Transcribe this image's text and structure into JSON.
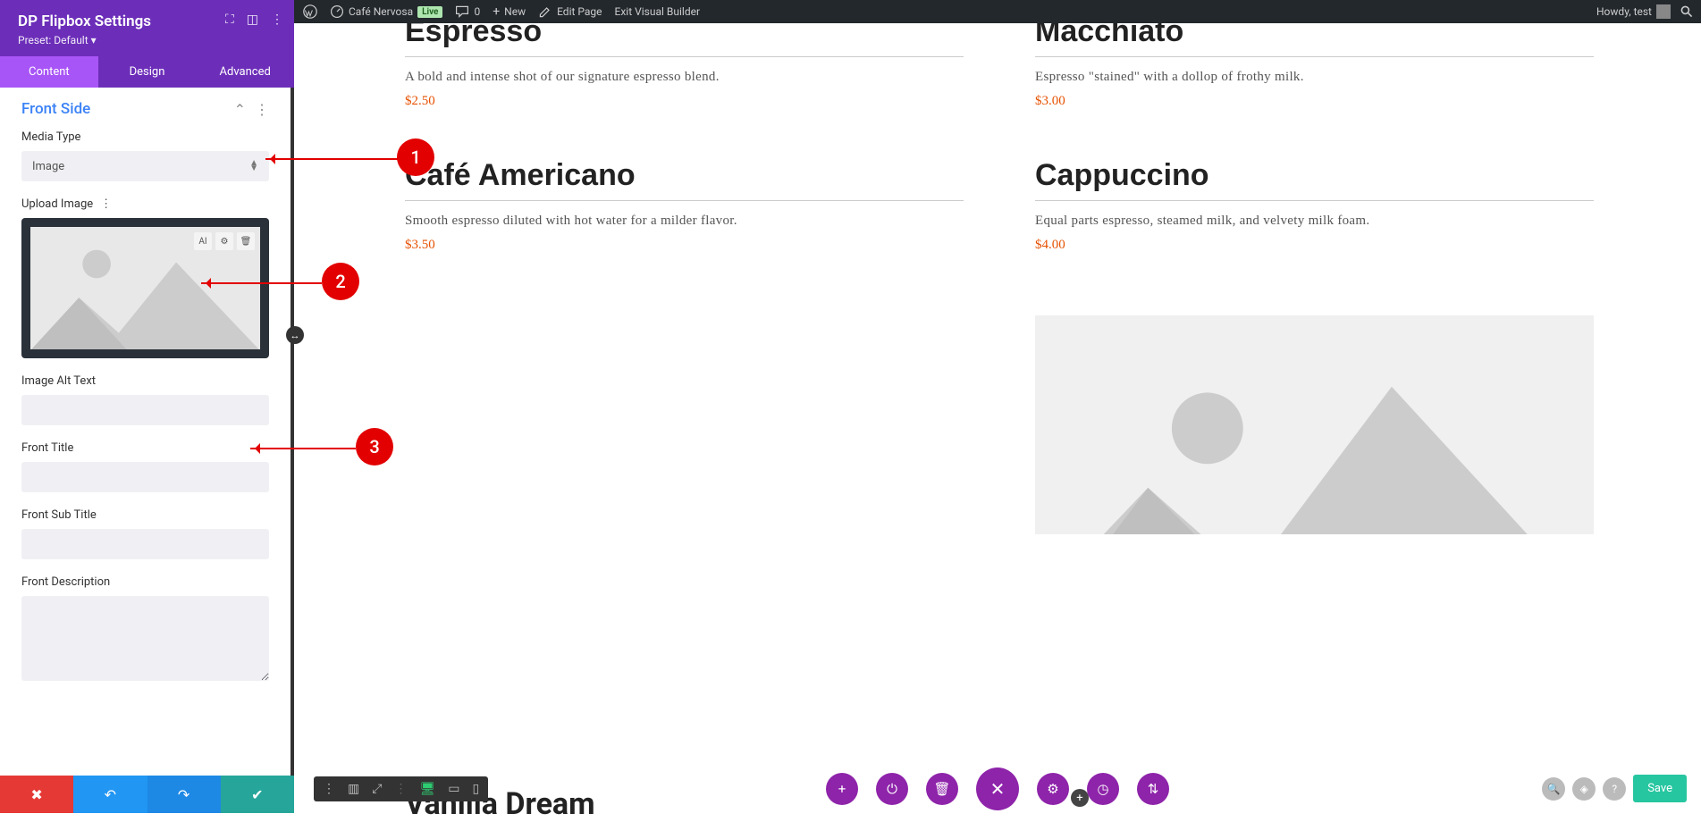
{
  "adminbar": {
    "site_name": "Café Nervosa",
    "live_badge": "Live",
    "comments_count": "0",
    "new_label": "New",
    "edit_page_label": "Edit Page",
    "exit_vb_label": "Exit Visual Builder",
    "howdy": "Howdy, test"
  },
  "sidebar": {
    "title": "DP Flipbox Settings",
    "preset_label": "Preset: Default",
    "tabs": {
      "content": "Content",
      "design": "Design",
      "advanced": "Advanced"
    },
    "section_title": "Front Side",
    "fields": {
      "media_type_label": "Media Type",
      "media_type_value": "Image",
      "upload_image_label": "Upload Image",
      "image_alt_label": "Image Alt Text",
      "image_alt_value": "",
      "front_title_label": "Front Title",
      "front_title_value": "",
      "front_subtitle_label": "Front Sub Title",
      "front_subtitle_value": "",
      "front_desc_label": "Front Description",
      "front_desc_value": ""
    },
    "upload_icons": {
      "ai": "AI",
      "gear": "⚙",
      "trash": "🗑"
    }
  },
  "callouts": {
    "one": "1",
    "two": "2",
    "three": "3"
  },
  "preview": {
    "items": [
      {
        "title": "Espresso",
        "desc": "A bold and intense shot of our signature espresso blend.",
        "price": "$2.50"
      },
      {
        "title": "Macchiato",
        "desc": "Espresso \"stained\" with a dollop of frothy milk.",
        "price": "$3.00"
      },
      {
        "title": "Café Americano",
        "desc": "Smooth espresso diluted with hot water for a milder flavor.",
        "price": "$3.50"
      },
      {
        "title": "Cappuccino",
        "desc": "Equal parts espresso, steamed milk, and velvety milk foam.",
        "price": "$4.00"
      }
    ],
    "vanilla": "Vanilla Dream"
  },
  "bottombar": {
    "save": "Save"
  }
}
